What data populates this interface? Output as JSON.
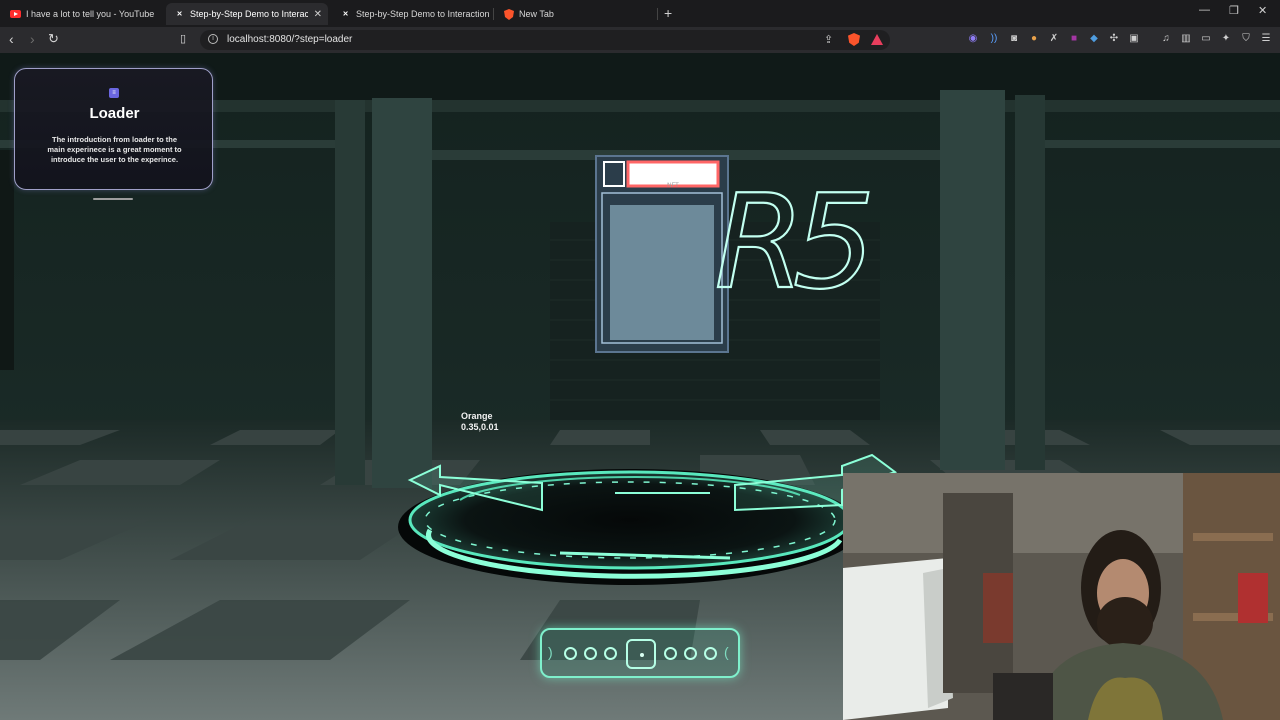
{
  "browser": {
    "tabs": [
      {
        "title": "I have a lot to tell you - YouTube",
        "favicon": "youtube-icon",
        "active": false
      },
      {
        "title": "Step-by-Step Demo to Interactio",
        "favicon": "site-icon",
        "active": true
      },
      {
        "title": "Step-by-Step Demo to Interaction in",
        "favicon": "site-icon",
        "active": false
      },
      {
        "title": "New Tab",
        "favicon": "brave-icon",
        "active": false
      }
    ],
    "url": "localhost:8080/?step=loader",
    "colors": {
      "tabbar": "#1b1b1d",
      "toolbar": "#2b2b2e",
      "urlbar": "#1f1f21"
    }
  },
  "scene": {
    "info_card": {
      "title": "Loader",
      "text": "The introduction from loader to the main experinece is a great moment to introduce the user to the experince.",
      "accent": "#6a66e0"
    },
    "label": {
      "name": "Orange",
      "value": "0.35,0.01"
    },
    "sign_text": "R5",
    "nft_label": "NFT",
    "stepper": {
      "dots_before": 3,
      "dots_after": 3,
      "current_step": 4,
      "accent": "#7ff0cc"
    }
  }
}
